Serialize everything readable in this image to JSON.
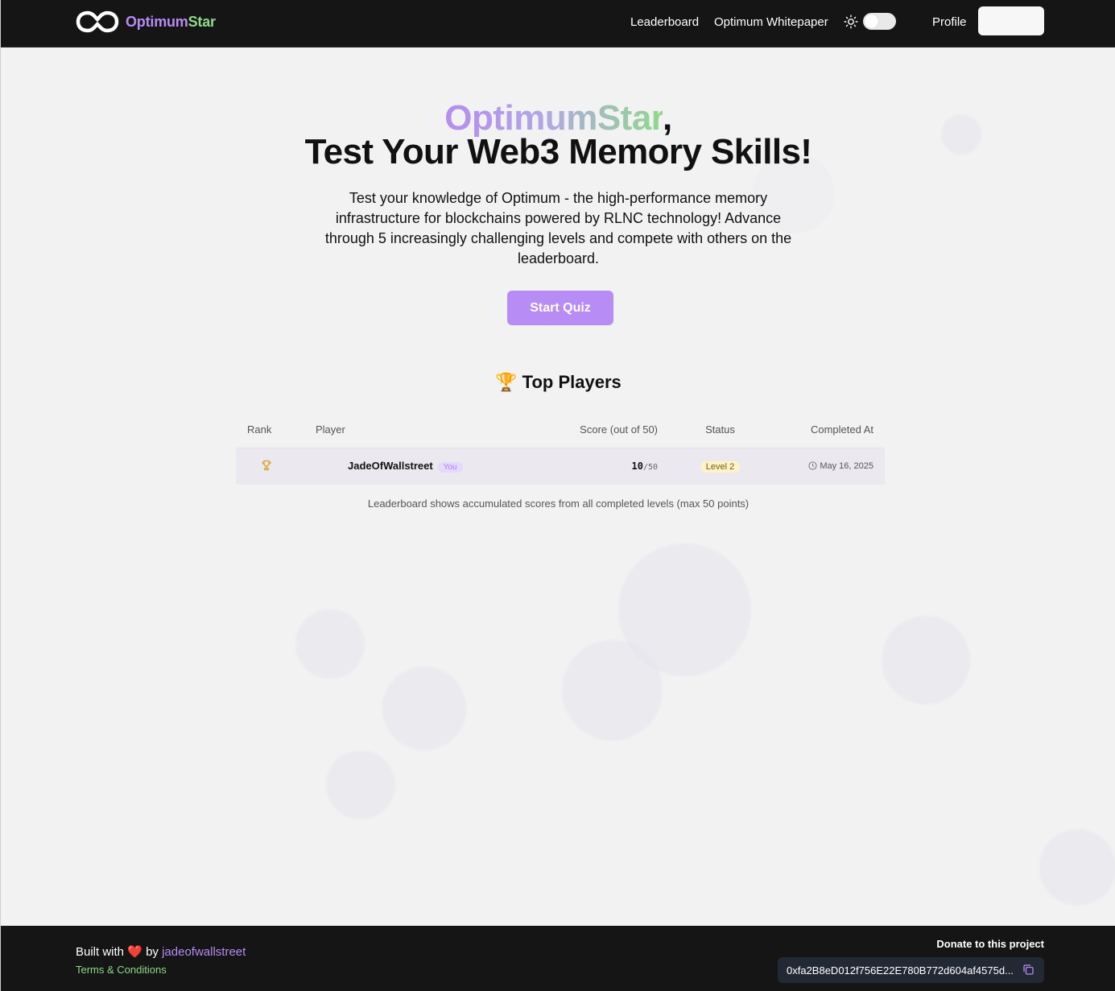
{
  "nav": {
    "brand_optimum": "Optimum",
    "brand_star": "Star",
    "links": {
      "leaderboard": "Leaderboard",
      "whitepaper": "Optimum Whitepaper",
      "profile": "Profile"
    },
    "theme_icon": "sun-icon"
  },
  "hero": {
    "brand": "OptimumStar",
    "comma": ",",
    "title": "Test Your Web3 Memory Skills!",
    "description": "Test your knowledge of Optimum - the high-performance memory infrastructure for blockchains powered by RLNC technology! Advance through 5 increasingly challenging levels and compete with others on the leaderboard.",
    "cta": "Start Quiz"
  },
  "leaderboard": {
    "title": "Top Players",
    "title_icon": "🏆",
    "columns": {
      "rank": "Rank",
      "player": "Player",
      "score": "Score (out of 50)",
      "status": "Status",
      "completed": "Completed At"
    },
    "rows": [
      {
        "rank_icon": "trophy-icon",
        "player": "JadeOfWallstreet",
        "badge": "You",
        "score": "10",
        "score_max": "/50",
        "status": "Level 2",
        "completed": "May 16, 2025"
      }
    ],
    "note": "Leaderboard shows accumulated scores from all completed levels (max 50 points)"
  },
  "footer": {
    "built_with": "Built with",
    "heart": "❤️",
    "by": "by",
    "author": "jadeofwallstreet",
    "terms": "Terms & Conditions",
    "donate_label": "Donate to this project",
    "address": "0xfa2B8eD012f756E22E780B772d604af4575d..."
  },
  "colors": {
    "accent_purple": "#b78cf5",
    "accent_green": "#8fd98a",
    "dark": "#151515"
  }
}
